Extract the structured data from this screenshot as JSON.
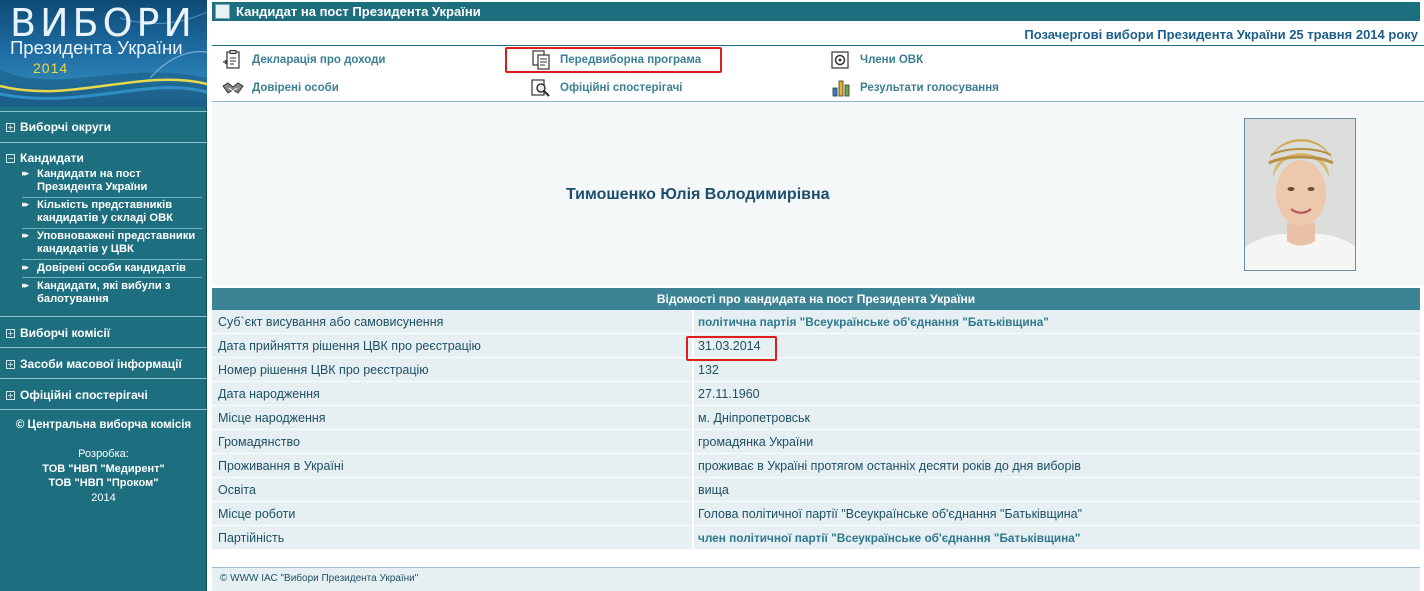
{
  "logo": {
    "title": "ВИБОРИ",
    "subtitle": "Президента України",
    "year": "2014"
  },
  "sidebar": {
    "sections": [
      {
        "label": "Виборчі округи"
      },
      {
        "label": "Кандидати"
      },
      {
        "label": "Виборчі комісії"
      },
      {
        "label": "Засоби масової інформації"
      },
      {
        "label": "Офіційні спостерігачі"
      }
    ],
    "candidate_items": [
      {
        "line1": "Кандидати на пост",
        "line2": "Президента України"
      },
      {
        "line1": "Кількість представників",
        "line2": "кандидатів у складі ОВК"
      },
      {
        "line1": "Уповноважені представники",
        "line2": "кандидатів у ЦВК"
      },
      {
        "line1": "Довірені особи кандидатів",
        "line2": ""
      },
      {
        "line1": "Кандидати, які вибули з",
        "line2": "балотування"
      }
    ],
    "copyright": "© Центральна виборча комісія",
    "developer": {
      "label": "Розробка:",
      "line1": "ТОВ \"НВП \"Медирент\"",
      "line2": "ТОВ \"НВП \"Проком\"",
      "year": "2014"
    }
  },
  "header": {
    "title": "Кандидат на пост Президента України",
    "subtitle": "Позачергові вибори Президента України 25 травня 2014 року"
  },
  "menu": {
    "declaration": "Декларація про доходи",
    "program": "Передвиборна програма",
    "ovk_members": "Члени ОВК",
    "trusted": "Довірені особи",
    "observers": "Офіційні спостерігачі",
    "results": "Результати голосування"
  },
  "candidate": {
    "name": "Тимошенко Юлія Володимирівна"
  },
  "info": {
    "heading": "Відомості про кандидата на пост Президента України",
    "rows": [
      {
        "k": "Суб`єкт висування або самовисунення",
        "v": "політична партія \"Всеукраїнське об'єднання \"Батьківщина\""
      },
      {
        "k": "Дата прийняття рішення ЦВК про реєстрацію",
        "v": "31.03.2014"
      },
      {
        "k": "Номер рішення ЦВК про реєстрацію",
        "v": "132"
      },
      {
        "k": "Дата народження",
        "v": "27.11.1960"
      },
      {
        "k": "Місце народження",
        "v": "м. Дніпропетровськ"
      },
      {
        "k": "Громадянство",
        "v": "громадянка України"
      },
      {
        "k": "Проживання в Україні",
        "v": "проживає в Україні протягом останніх десяти років до дня виборів"
      },
      {
        "k": "Освіта",
        "v": "вища"
      },
      {
        "k": "Місце роботи",
        "v": "Голова політичної партії \"Всеукраїнське об'єднання \"Батьківщина\""
      },
      {
        "k": "Партійність",
        "v": "член політичної партії \"Всеукраїнське об'єднання \"Батьківщина\""
      }
    ]
  },
  "footer": {
    "text": "© WWW ІАС \"Вибори Президента України\""
  },
  "colors": {
    "sidebar_bg": "#1d6f80",
    "table_header": "#3d8396",
    "row_bg": "#e6eff2",
    "highlight": "#e01d1d",
    "link": "#2f7890"
  }
}
